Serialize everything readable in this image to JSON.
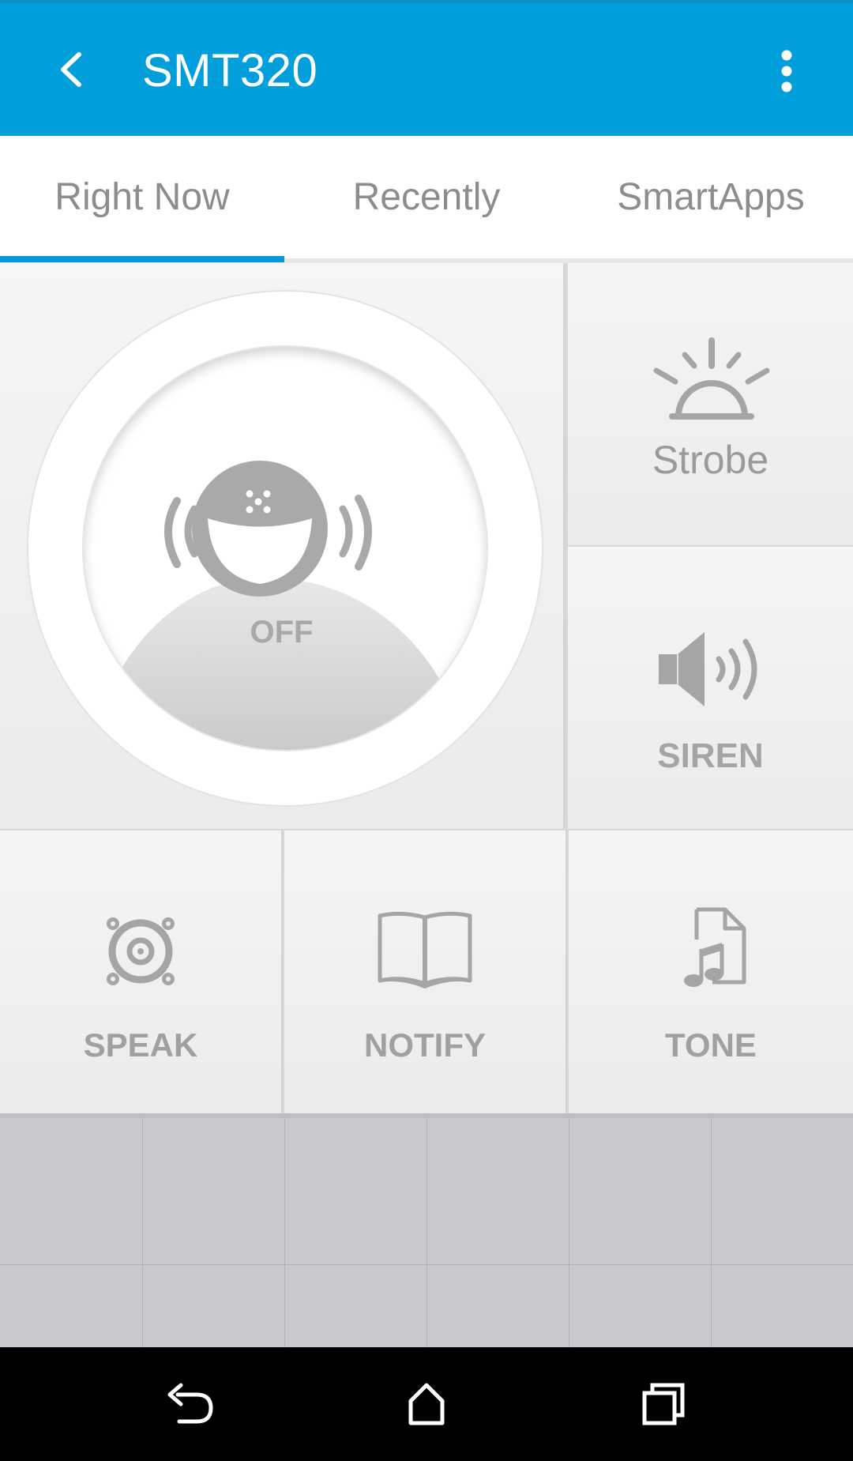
{
  "app_bar": {
    "title": "SMT320",
    "back_icon": "chevron-left-icon",
    "overflow_icon": "more-vert-icon",
    "color": "#009fdc"
  },
  "tabs": [
    {
      "label": "Right Now",
      "active": true
    },
    {
      "label": "Recently",
      "active": false
    },
    {
      "label": "SmartApps",
      "active": false
    }
  ],
  "accent_color": "#0797d6",
  "main_tile": {
    "state_label": "OFF",
    "icon": "alarm-person-icon"
  },
  "side_tiles": [
    {
      "label": "Strobe",
      "icon": "strobe-icon"
    },
    {
      "label": "SIREN",
      "icon": "speaker-icon"
    }
  ],
  "action_tiles": [
    {
      "label": "SPEAK",
      "icon": "speaker-cone-icon"
    },
    {
      "label": "NOTIFY",
      "icon": "book-icon"
    },
    {
      "label": "TONE",
      "icon": "music-file-icon"
    }
  ],
  "nav_bar": {
    "back_icon": "nav-back-icon",
    "home_icon": "nav-home-icon",
    "recents_icon": "nav-recents-icon"
  }
}
